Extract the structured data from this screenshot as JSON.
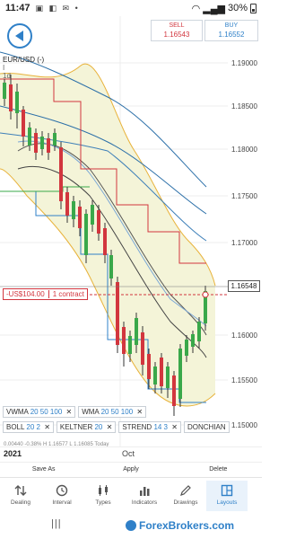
{
  "status": {
    "time": "11:47",
    "battery": "30%"
  },
  "quotes": {
    "sell_label": "SELL",
    "sell_price": "1.16543",
    "buy_label": "BUY",
    "buy_price": "1.16552"
  },
  "symbol": {
    "name": "EUR/USD (-)",
    "line2": "I",
    "timeframe": "1d"
  },
  "price_axis": {
    "labels": [
      "1.19000",
      "1.18500",
      "1.18000",
      "1.17500",
      "1.17000",
      "1.16000",
      "1.15500",
      "1.15000"
    ]
  },
  "current_price": "1.16548",
  "position": {
    "pnl": "-US$104.00",
    "size": "1 contract"
  },
  "indicators_row1": [
    {
      "label": "VWMA",
      "params": "20  50  100"
    },
    {
      "label": "WMA",
      "params": "20  50  100"
    }
  ],
  "indicators_row2": [
    {
      "label": "BOLL",
      "params": "20  2"
    },
    {
      "label": "KELTNER",
      "params": "20"
    },
    {
      "label": "STREND",
      "params": "14  3"
    },
    {
      "label": "DONCHIAN",
      "params": ""
    }
  ],
  "ohlc_strip": "0.00440  -0.38%   H 1.16577   L 1.16085   Today",
  "time_axis": {
    "year": "2021",
    "month": "Oct"
  },
  "actions": {
    "save_as": "Save As",
    "apply": "Apply",
    "delete": "Delete"
  },
  "nav": [
    {
      "label": "Dealing",
      "icon": "arrows-up-down-icon"
    },
    {
      "label": "Interval",
      "icon": "clock-icon"
    },
    {
      "label": "Types",
      "icon": "candles-icon"
    },
    {
      "label": "Indicators",
      "icon": "bar-chart-icon"
    },
    {
      "label": "Drawings",
      "icon": "pencil-icon"
    },
    {
      "label": "Layouts",
      "icon": "layout-icon"
    }
  ],
  "watermark": "ForexBrokers.com",
  "colors": {
    "accent": "#2f80c8",
    "sell": "#d2363e",
    "up_candle": "#3aa84a",
    "down_candle": "#d2363e",
    "band_fill": "#f4f4d8",
    "band_line": "#e8b23a"
  }
}
